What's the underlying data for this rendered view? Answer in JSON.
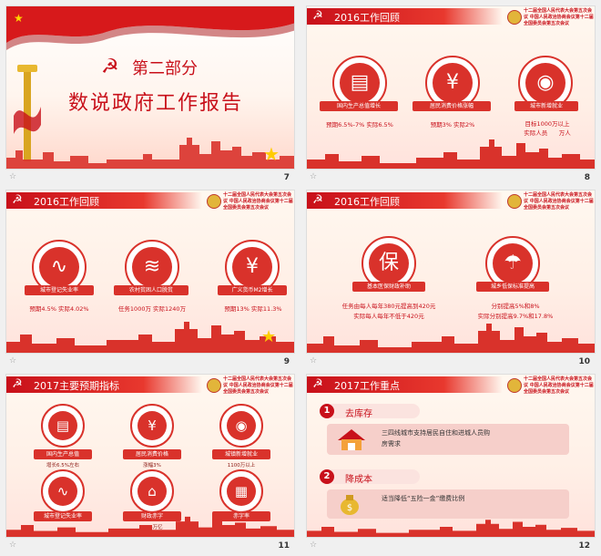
{
  "slides": {
    "s7": {
      "num": "7",
      "part_label": "第二部分",
      "subtitle": "数说政府工作报告"
    },
    "s8": {
      "num": "8",
      "header": "2016工作回顾",
      "items": [
        {
          "icon": "chart-doc-icon",
          "label": "国内生产总值增长",
          "note": "预期6.5%-7% 实际6.5%"
        },
        {
          "icon": "price-tag-icon",
          "label": "居民消费价格涨幅",
          "note": "预期3% 实际2%"
        },
        {
          "icon": "broadcast-icon",
          "label": "城市新增就业",
          "note": "目标1000万以上\n实际人员      万人"
        }
      ]
    },
    "s9": {
      "num": "9",
      "header": "2016工作回顾",
      "items": [
        {
          "icon": "pulse-icon",
          "label": "城市登记失业率",
          "note": "预期4.5% 实际4.02%"
        },
        {
          "icon": "coins-icon",
          "label": "农村贫困人口脱贫",
          "note": "任务1000万 实际1240万"
        },
        {
          "icon": "yen-icon",
          "label": "广义货币M2增长",
          "note": "预期13% 实际11.3%"
        }
      ]
    },
    "s10": {
      "num": "10",
      "header": "2016工作回顾",
      "items": [
        {
          "icon": "bao-icon",
          "glyph": "保",
          "label": "基本医保财政补助",
          "note": "任务由每人每年380元提高到420元\n实际每人每年不低于420元"
        },
        {
          "icon": "umbrella-icon",
          "label": "城乡低保标准提高",
          "note": "分别提高5%和8%\n实际分别提高9.7%和17.8%"
        }
      ]
    },
    "s11": {
      "num": "11",
      "header": "2017主要预期指标",
      "items": [
        {
          "icon": "chart-doc-icon",
          "label": "国内生产总值",
          "note": "增长6.5%左右"
        },
        {
          "icon": "price-tag-icon",
          "label": "居民消费价格",
          "note": "涨幅3%"
        },
        {
          "icon": "broadcast-icon",
          "label": "城镇新增就业",
          "note": "1100万以上"
        },
        {
          "icon": "pulse-icon",
          "label": "城市登记失业率",
          "note": ""
        },
        {
          "icon": "house-yen-icon",
          "label": "财政赤字",
          "note": "2.38万亿"
        },
        {
          "icon": "document-yen-icon",
          "label": "赤字率",
          "note": ""
        }
      ]
    },
    "s12": {
      "num": "12",
      "header": "2017工作重点",
      "points": [
        {
          "num": "1",
          "title": "去库存",
          "text": "三四线城市支持居民自住和进城人员购房需求"
        },
        {
          "num": "2",
          "title": "降成本",
          "text": "适当降低“五险一金”缴费比例"
        }
      ]
    }
  },
  "conference_text": "十二届全国人民代表大会第五次会议\n中国人民政治协商会议第十二届全国委员会第五次会议",
  "footer_icon": "star-icon",
  "colors": {
    "primary": "#c8101a",
    "accent": "#e2b53a"
  }
}
